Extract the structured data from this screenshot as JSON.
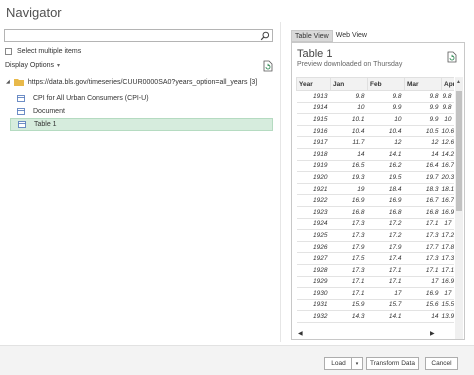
{
  "window": {
    "title": "Navigator"
  },
  "search": {
    "placeholder": "",
    "value": ""
  },
  "left": {
    "select_multiple_label": "Select multiple items",
    "display_options_label": "Display Options",
    "display_options_chevron": "▾",
    "tree": {
      "root_label": "https://data.bls.gov/timeseries/CUUR0000SA0?years_option=all_years [3]",
      "items": [
        {
          "label": "CPI for All Urban Consumers (CPI-U)",
          "selected": false
        },
        {
          "label": "Document",
          "selected": false
        },
        {
          "label": "Table 1",
          "selected": true
        }
      ]
    }
  },
  "right": {
    "tabs": [
      {
        "label": "Table View",
        "active": true
      },
      {
        "label": "Web View",
        "active": false
      }
    ],
    "preview_title": "Table 1",
    "preview_subtitle": "Preview downloaded on Thursday",
    "columns": [
      "Year",
      "Jan",
      "Feb",
      "Mar",
      "Apr"
    ],
    "rows": [
      [
        "1913",
        "9.8",
        "9.8",
        "9.8",
        "9.8"
      ],
      [
        "1914",
        "10",
        "9.9",
        "9.9",
        "9.8"
      ],
      [
        "1915",
        "10.1",
        "10",
        "9.9",
        "10"
      ],
      [
        "1916",
        "10.4",
        "10.4",
        "10.5",
        "10.6"
      ],
      [
        "1917",
        "11.7",
        "12",
        "12",
        "12.6"
      ],
      [
        "1918",
        "14",
        "14.1",
        "14",
        "14.2"
      ],
      [
        "1919",
        "16.5",
        "16.2",
        "16.4",
        "16.7"
      ],
      [
        "1920",
        "19.3",
        "19.5",
        "19.7",
        "20.3"
      ],
      [
        "1921",
        "19",
        "18.4",
        "18.3",
        "18.1"
      ],
      [
        "1922",
        "16.9",
        "16.9",
        "16.7",
        "16.7"
      ],
      [
        "1923",
        "16.8",
        "16.8",
        "16.8",
        "16.9"
      ],
      [
        "1924",
        "17.3",
        "17.2",
        "17.1",
        "17"
      ],
      [
        "1925",
        "17.3",
        "17.2",
        "17.3",
        "17.2"
      ],
      [
        "1926",
        "17.9",
        "17.9",
        "17.7",
        "17.8"
      ],
      [
        "1927",
        "17.5",
        "17.4",
        "17.3",
        "17.3"
      ],
      [
        "1928",
        "17.3",
        "17.1",
        "17.1",
        "17.1"
      ],
      [
        "1929",
        "17.1",
        "17.1",
        "17",
        "16.9"
      ],
      [
        "1930",
        "17.1",
        "17",
        "16.9",
        "17"
      ],
      [
        "1931",
        "15.9",
        "15.7",
        "15.6",
        "15.5"
      ],
      [
        "1932",
        "14.3",
        "14.1",
        "14",
        "13.9"
      ]
    ]
  },
  "footer": {
    "load_label": "Load",
    "load_dropdown": "▾",
    "transform_label": "Transform Data",
    "cancel_label": "Cancel"
  },
  "colors": {
    "selected_bg": "#d6ecdd",
    "header_bg": "#f2f2f2"
  }
}
